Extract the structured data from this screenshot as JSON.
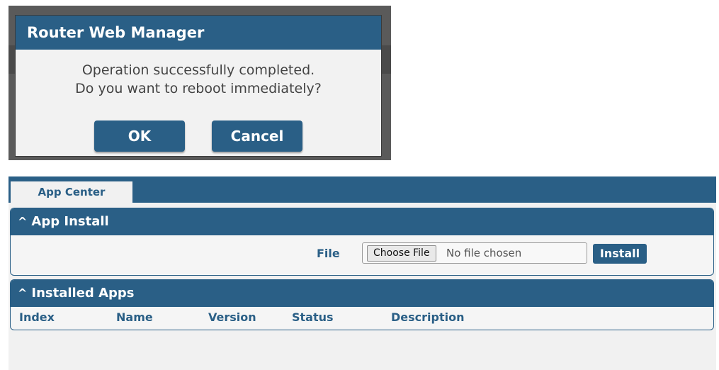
{
  "dialog": {
    "title": "Router Web Manager",
    "message_line1": "Operation successfully completed.",
    "message_line2": "Do you want to reboot immediately?",
    "ok_label": "OK",
    "cancel_label": "Cancel"
  },
  "app_center": {
    "tab_label": "App Center",
    "install_section": {
      "title": "App Install",
      "file_label": "File",
      "choose_file_label": "Choose File",
      "no_file_text": "No file chosen",
      "install_label": "Install"
    },
    "installed_section": {
      "title": "Installed Apps",
      "columns": [
        "Index",
        "Name",
        "Version",
        "Status",
        "Description"
      ]
    }
  },
  "colors": {
    "accent": "#2a5f86",
    "panel_bg": "#f1f1f1",
    "dialog_bg": "#f2f2f2"
  },
  "icons": {
    "section_toggle": "chevron-up-icon"
  }
}
